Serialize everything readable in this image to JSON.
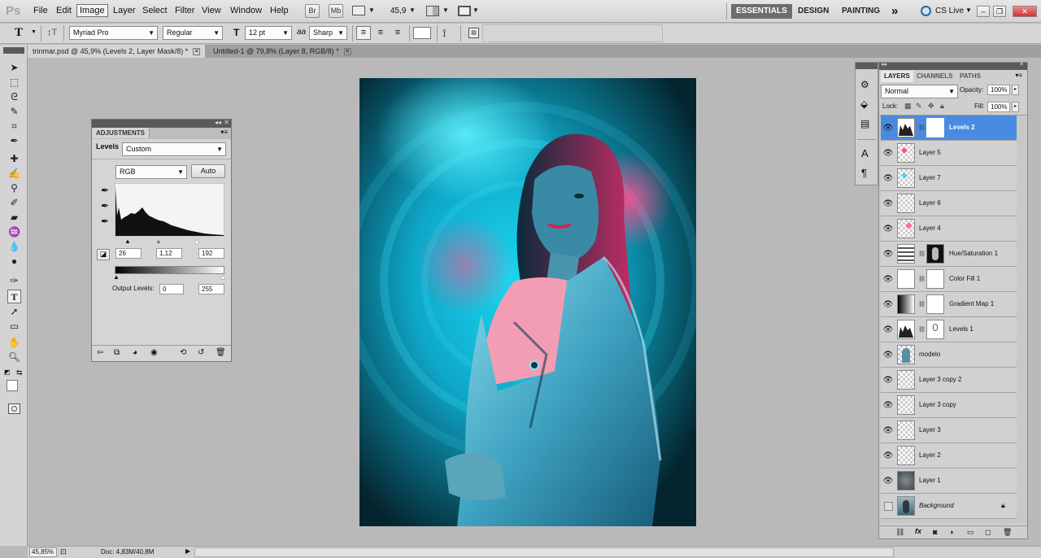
{
  "menubar": {
    "logo": "Ps",
    "items": [
      "File",
      "Edit",
      "Image",
      "Layer",
      "Select",
      "Filter",
      "View",
      "Window",
      "Help"
    ],
    "active_item": "Image",
    "bridge_label": "Br",
    "minibridge_label": "Mb",
    "zoom_value": "45,9",
    "workspaces": [
      "ESSENTIALS",
      "DESIGN",
      "PAINTING"
    ],
    "more_label": "»",
    "cs_live": "CS Live"
  },
  "options": {
    "font_family": "Myriad Pro",
    "font_style": "Regular",
    "font_size": "12 pt",
    "aa_label": "aa",
    "antialias": "Sharp"
  },
  "tabs": [
    {
      "label": "trinmar.psd @ 45,9% (Levels 2, Layer Mask/8) *",
      "active": true
    },
    {
      "label": "Untitled-1 @ 79,8% (Layer 8, RGB/8) *",
      "active": false
    }
  ],
  "adjustments": {
    "panel_title": "ADJUSTMENTS",
    "adjustment_label": "Levels",
    "preset": "Custom",
    "channel": "RGB",
    "auto_label": "Auto",
    "input_black": "26",
    "input_gamma": "1,12",
    "input_white": "192",
    "output_label": "Output Levels:",
    "output_black": "0",
    "output_white": "255"
  },
  "layers_panel": {
    "tabs": [
      "LAYERS",
      "CHANNELS",
      "PATHS"
    ],
    "blend_mode": "Normal",
    "opacity_label": "Opacity:",
    "opacity": "100%",
    "lock_label": "Lock:",
    "fill_label": "Fill:",
    "fill": "100%",
    "layers": [
      {
        "name": "Levels 2",
        "selected": true,
        "visible": true
      },
      {
        "name": "Layer 5",
        "selected": false,
        "visible": true
      },
      {
        "name": "Layer 7",
        "selected": false,
        "visible": true
      },
      {
        "name": "Layer 6",
        "selected": false,
        "visible": true
      },
      {
        "name": "Layer 4",
        "selected": false,
        "visible": true
      },
      {
        "name": "Hue/Saturation 1",
        "selected": false,
        "visible": true
      },
      {
        "name": "Color Fill 1",
        "selected": false,
        "visible": true
      },
      {
        "name": "Gradient Map 1",
        "selected": false,
        "visible": true
      },
      {
        "name": "Levels 1",
        "selected": false,
        "visible": true
      },
      {
        "name": "modelo",
        "selected": false,
        "visible": true
      },
      {
        "name": "Layer 3 copy 2",
        "selected": false,
        "visible": true
      },
      {
        "name": "Layer 3 copy",
        "selected": false,
        "visible": true
      },
      {
        "name": "Layer 3",
        "selected": false,
        "visible": true
      },
      {
        "name": "Layer 2",
        "selected": false,
        "visible": true
      },
      {
        "name": "Layer 1",
        "selected": false,
        "visible": true
      },
      {
        "name": "Background",
        "selected": false,
        "visible": false
      }
    ]
  },
  "status": {
    "zoom": "45,85%",
    "doc": "Doc: 4,83M/40,8M"
  },
  "colors": {
    "selection_blue": "#4a8ae0",
    "canvas_cyan": "#12c6e6",
    "canvas_pink": "#ff4f8e"
  }
}
